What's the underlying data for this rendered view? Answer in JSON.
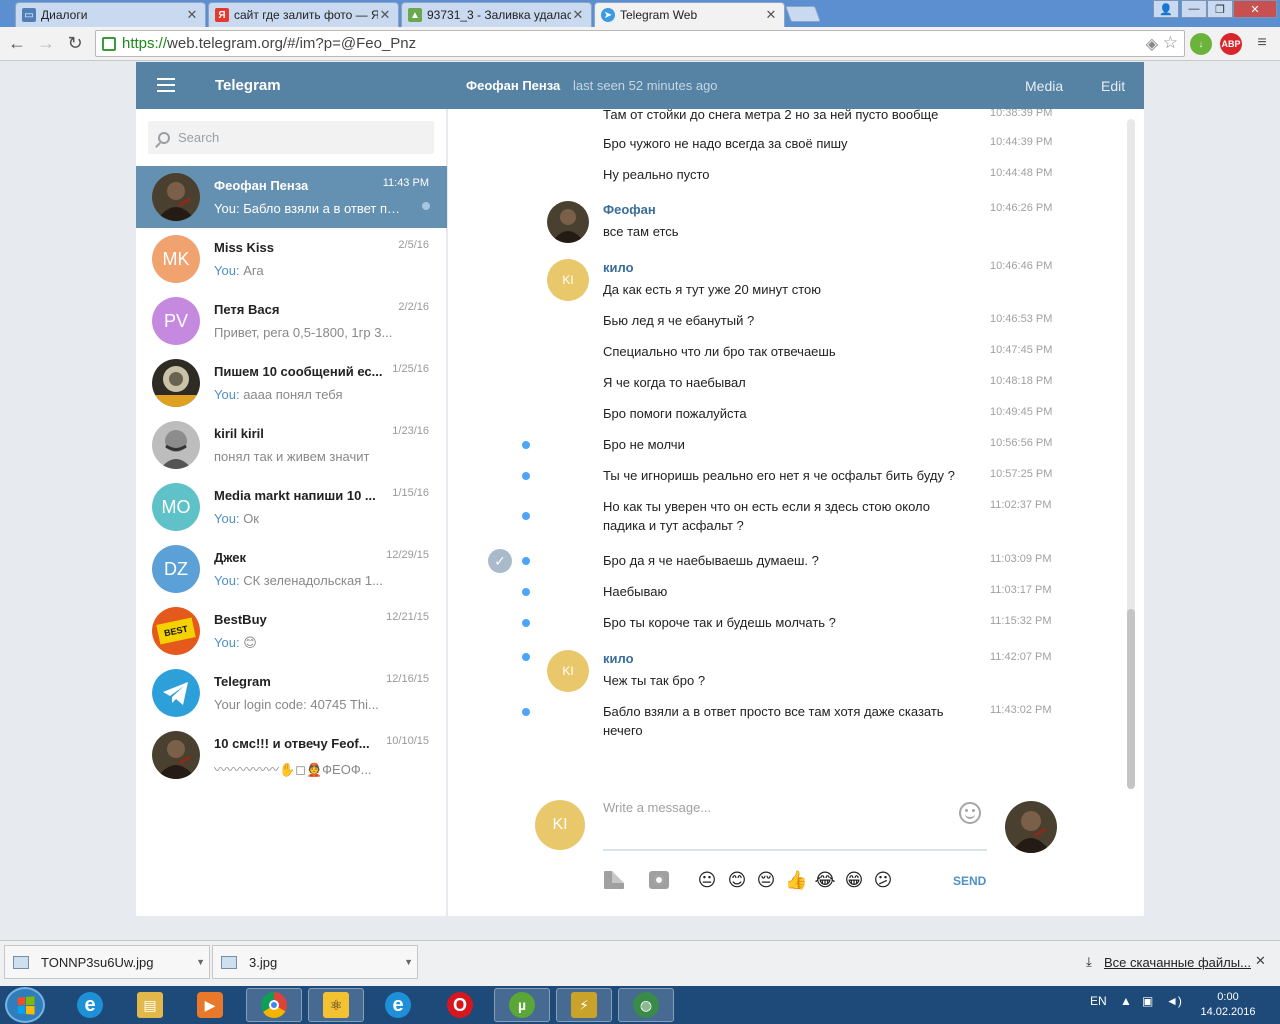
{
  "browser": {
    "tabs": [
      {
        "title": "Диалоги",
        "fav_color": "#4e7fb6"
      },
      {
        "title": "сайт где залить фото — Я",
        "fav_color": "#e23a2f"
      },
      {
        "title": "93731_3 - Заливка удалас",
        "fav_color": "#6aa84f"
      },
      {
        "title": "Telegram Web",
        "fav_color": "#3b9ae0"
      }
    ],
    "url_scheme": "https://",
    "url_rest": "web.telegram.org/#/im?p=@Feo_Pnz",
    "adblock_label": "ABP"
  },
  "app": {
    "title": "Telegram",
    "peer_name": "Феофан Пенза",
    "peer_status": "last seen 52 minutes ago",
    "media_label": "Media",
    "edit_label": "Edit"
  },
  "search": {
    "placeholder": "Search"
  },
  "you_prefix": "You:",
  "dialogs": [
    {
      "name": "Феофан Пенза",
      "date": "11:43 PM",
      "you": true,
      "msg": "Бабло взяли а в ответ просто все там",
      "initials": "",
      "color": "#5a4a3a",
      "active": true
    },
    {
      "name": "Miss Kiss",
      "date": "2/5/16",
      "you": true,
      "msg": "Ага",
      "initials": "MK",
      "color": "#f0a36f"
    },
    {
      "name": "Петя Вася",
      "date": "2/2/16",
      "you": false,
      "msg": "Привет, рега 0,5-1800, 1гр 3...",
      "initials": "PV",
      "color": "#c58ae0"
    },
    {
      "name": "Пишем 10 сообщений ес...",
      "date": "1/25/16",
      "you": true,
      "msg": "аааа понял тебя",
      "initials": "",
      "color": "#3a3a2e"
    },
    {
      "name": "kiril kiril",
      "date": "1/23/16",
      "you": false,
      "msg": "понял так и живем значит",
      "initials": "",
      "color": "#9c9c9c"
    },
    {
      "name": "Media markt напиши 10 ...",
      "date": "1/15/16",
      "you": true,
      "msg": "Ок",
      "initials": "MO",
      "color": "#5ec2c8"
    },
    {
      "name": "Джек",
      "date": "12/29/15",
      "you": true,
      "msg": "СК зеленадольская 1...",
      "initials": "DZ",
      "color": "#5ca0d8"
    },
    {
      "name": "BestBuy",
      "date": "12/21/15",
      "you": true,
      "msg": "😊",
      "initials": "",
      "color": "#2a2a2a"
    },
    {
      "name": "Telegram",
      "date": "12/16/15",
      "you": false,
      "msg": "Your login code: 40745 Thi...",
      "initials": "",
      "color": "#2d9fd9"
    },
    {
      "name": "10 смс!!! и отвечу Feof...",
      "date": "10/10/15",
      "you": false,
      "msg": "〰〰〰〰〰✋◻👲ФЕОФ...",
      "initials": "",
      "color": "#5a4a3a"
    }
  ],
  "messages": [
    {
      "text": "Там от стойки до снега метра 2 но за ней пусто вообще",
      "time": "10:38:39 PM"
    },
    {
      "text": "Бро чужого не надо всегда за своё пишу",
      "time": "10:44:39 PM"
    },
    {
      "text": "Ну реально пусто",
      "time": "10:44:48 PM"
    },
    {
      "author": "Феофан",
      "text": "все там етсь",
      "time": "10:46:26 PM"
    },
    {
      "author": "кило",
      "text": "Да как есть я тут уже 20 минут стою",
      "time": "10:46:46 PM"
    },
    {
      "text": "Бью лед я че ебанутый ?",
      "time": "10:46:53 PM"
    },
    {
      "text": "Специально что ли бро так отвечаешь",
      "time": "10:47:45 PM"
    },
    {
      "text": "Я че когда то наебывал",
      "time": "10:48:18 PM"
    },
    {
      "text": "Бро помоги пожалуйста",
      "time": "10:49:45 PM"
    },
    {
      "text": "Бро не молчи",
      "time": "10:56:56 PM"
    },
    {
      "text": "Ты че игноришь реально его нет я че осфальт бить буду ?",
      "time": "10:57:25 PM"
    },
    {
      "text": "Но как ты уверен что он есть если я здесь стою около падика и тут асфальт ?",
      "time": "11:02:37 PM"
    },
    {
      "text": "Бро да я че наебываешь думаеш. ?",
      "time": "11:03:09 PM"
    },
    {
      "text": "Наебываю",
      "time": "11:03:17 PM"
    },
    {
      "text": "Бро ты короче так и будешь молчать ?",
      "time": "11:15:32 PM"
    },
    {
      "author": "кило",
      "text": "Чеж ты так бро ?",
      "time": "11:42:07 PM"
    },
    {
      "text": "Бабло взяли а в ответ просто все там хотя даже сказать нечего",
      "time": "11:43:02 PM"
    }
  ],
  "self_initials": "KI",
  "self_color": "#e8c86a",
  "compose": {
    "placeholder": "Write a message...",
    "send_label": "SEND"
  },
  "quick_emoji": [
    "😐",
    "😊",
    "😔",
    "👍",
    "😂",
    "😁",
    "😕"
  ],
  "downloads": {
    "files": [
      "TONNP3su6Uw.jpg",
      "3.jpg"
    ],
    "all_label": "Все скачанные файлы..."
  },
  "taskbar": {
    "lang": "EN",
    "time": "0:00",
    "date": "14.02.2016"
  }
}
